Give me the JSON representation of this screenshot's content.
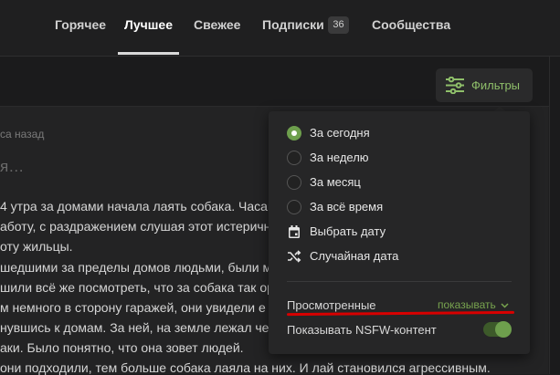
{
  "nav": {
    "tabs": [
      {
        "label": "Горячее"
      },
      {
        "label": "Лучшее"
      },
      {
        "label": "Свежее"
      },
      {
        "label": "Подписки",
        "badge": "36"
      },
      {
        "label": "Сообщества"
      }
    ],
    "active": "Лучшее"
  },
  "filter_button": {
    "label": "Фильтры",
    "icon": "sliders-icon",
    "color": "#8fbf6a"
  },
  "post": {
    "time": "са назад",
    "title": "я…",
    "lines": [
      "4 утра за домами начала лаять собака. Часам",
      "аботу, с раздражением слушая этот истеричн",
      "оту жильцы.",
      "шедшими за пределы домов людьми, были м",
      "шили всё же посмотреть, что за собака так ор",
      "м немного в сторону гаражей, они увидели е",
      "нувшись к домам. За ней, на земле лежал че",
      "аки. Было понятно, что она зовет людей.",
      " они подходили, тем больше собака лаяла на них. И лай становился агрессивным."
    ]
  },
  "filters": {
    "period_options": [
      {
        "label": "За сегодня",
        "selected": true
      },
      {
        "label": "За неделю",
        "selected": false
      },
      {
        "label": "За месяц",
        "selected": false
      },
      {
        "label": "За всё время",
        "selected": false
      }
    ],
    "pick_date": {
      "label": "Выбрать дату",
      "icon": "calendar-icon"
    },
    "random_date": {
      "label": "Случайная дата",
      "icon": "shuffle-icon"
    },
    "viewed": {
      "label": "Просмотренные",
      "value": "показывать"
    },
    "nsfw": {
      "label": "Показывать NSFW-контент",
      "enabled": true
    }
  },
  "colors": {
    "accent": "#6e9f4d",
    "annotation": "#d80000"
  }
}
